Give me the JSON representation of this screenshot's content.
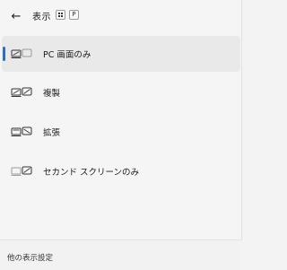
{
  "header": {
    "back_icon": "arrow-left-icon",
    "title": "表示",
    "shortcut_keys": [
      "windows-key",
      "P"
    ]
  },
  "options": [
    {
      "label": "PC 画面のみ",
      "icon": "pc-screen-only-icon",
      "selected": true
    },
    {
      "label": "複製",
      "icon": "duplicate-icon",
      "selected": false
    },
    {
      "label": "拡張",
      "icon": "extend-icon",
      "selected": false
    },
    {
      "label": "セカンド スクリーンのみ",
      "icon": "second-screen-only-icon",
      "selected": false
    }
  ],
  "footer": {
    "link_label": "他の表示設定"
  },
  "colors": {
    "accent": "#2f6fbf",
    "selected_bg": "#e9e9e9",
    "panel_bg": "#f5f5f5"
  }
}
